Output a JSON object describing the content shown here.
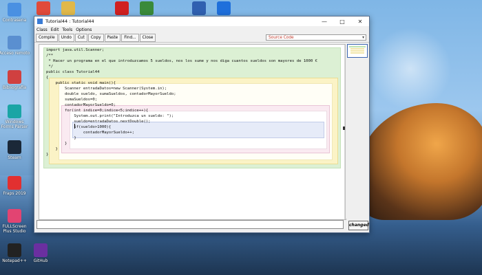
{
  "desktop": {
    "icons_left": [
      {
        "label": "Contrasena",
        "icon": "gear-icon",
        "color": "#4a90e2"
      },
      {
        "label": "Acceso remoto",
        "icon": "network-icon",
        "color": "#5a8fd0"
      },
      {
        "label": "Bibliografia",
        "icon": "book-icon",
        "color": "#d04040"
      },
      {
        "label": "Windows Forms Parser",
        "icon": "f-app-icon",
        "color": "#1aa5a5"
      },
      {
        "label": "Steam",
        "icon": "steam-icon",
        "color": "#1b2838"
      },
      {
        "label": "Fraps 2019",
        "icon": "fraps-icon",
        "color": "#e23030"
      },
      {
        "label": "FULLScreen Plus Studio",
        "icon": "fs-icon",
        "color": "#e24472"
      },
      {
        "label": "Notepad++",
        "icon": "n-app-icon",
        "color": "#222222"
      }
    ],
    "icons_left2": [
      {
        "label": "GitHub",
        "icon": "github-icon",
        "color": "#6b2fa0"
      }
    ],
    "icons_top": [
      {
        "label": "Chrome",
        "icon": "chrome-icon",
        "color": "#e04a3a"
      },
      {
        "label": "Folder",
        "icon": "folder-icon",
        "color": "#e0b84a"
      },
      {
        "label": "Adobe",
        "icon": "adobe-icon",
        "color": "#d02020"
      },
      {
        "label": "Paint",
        "icon": "paint-icon",
        "color": "#3a8a3a"
      },
      {
        "label": "BlueJ",
        "icon": "bluej-icon",
        "color": "#3060b0"
      },
      {
        "label": "Dropbox",
        "icon": "dropbox-icon",
        "color": "#1e6fdb"
      }
    ]
  },
  "window": {
    "title": "Tutorial44 : Tutorial44",
    "menu": [
      "Class",
      "Edit",
      "Tools",
      "Options"
    ],
    "toolbar": [
      "Compile",
      "Undo",
      "Cut",
      "Copy",
      "Paste",
      "Find...",
      "Close"
    ],
    "view_select": "Source Code",
    "status_button": "changed"
  },
  "code_lines": [
    "import java.util.Scanner;",
    "/**",
    " * Hacer un programa en el que introduzcamos 5 sueldos, nos los sume y nos diga cuantos sueldos son mayores de 1000 €",
    " */",
    "public class Tutorial44",
    "{",
    "    public static void main(){",
    "        Scanner entradaDatos=new Scanner(System.in);",
    "        double sueldo, sumaSueldos, contadorMayorSueldo;",
    "        sumaSueldos=0;",
    "        contadorMayorSueldo=0;",
    "        for(int indice=0;indice<5;indice++){",
    "            System.out.print(\"Introduzca un sueldo: \");",
    "            sueldo=entradaDatos.nextDouble();",
    "            if(sueldo>1000){",
    "                contadorMayorSueldo++;",
    "            }",
    "        }",
    "    }",
    "}"
  ]
}
